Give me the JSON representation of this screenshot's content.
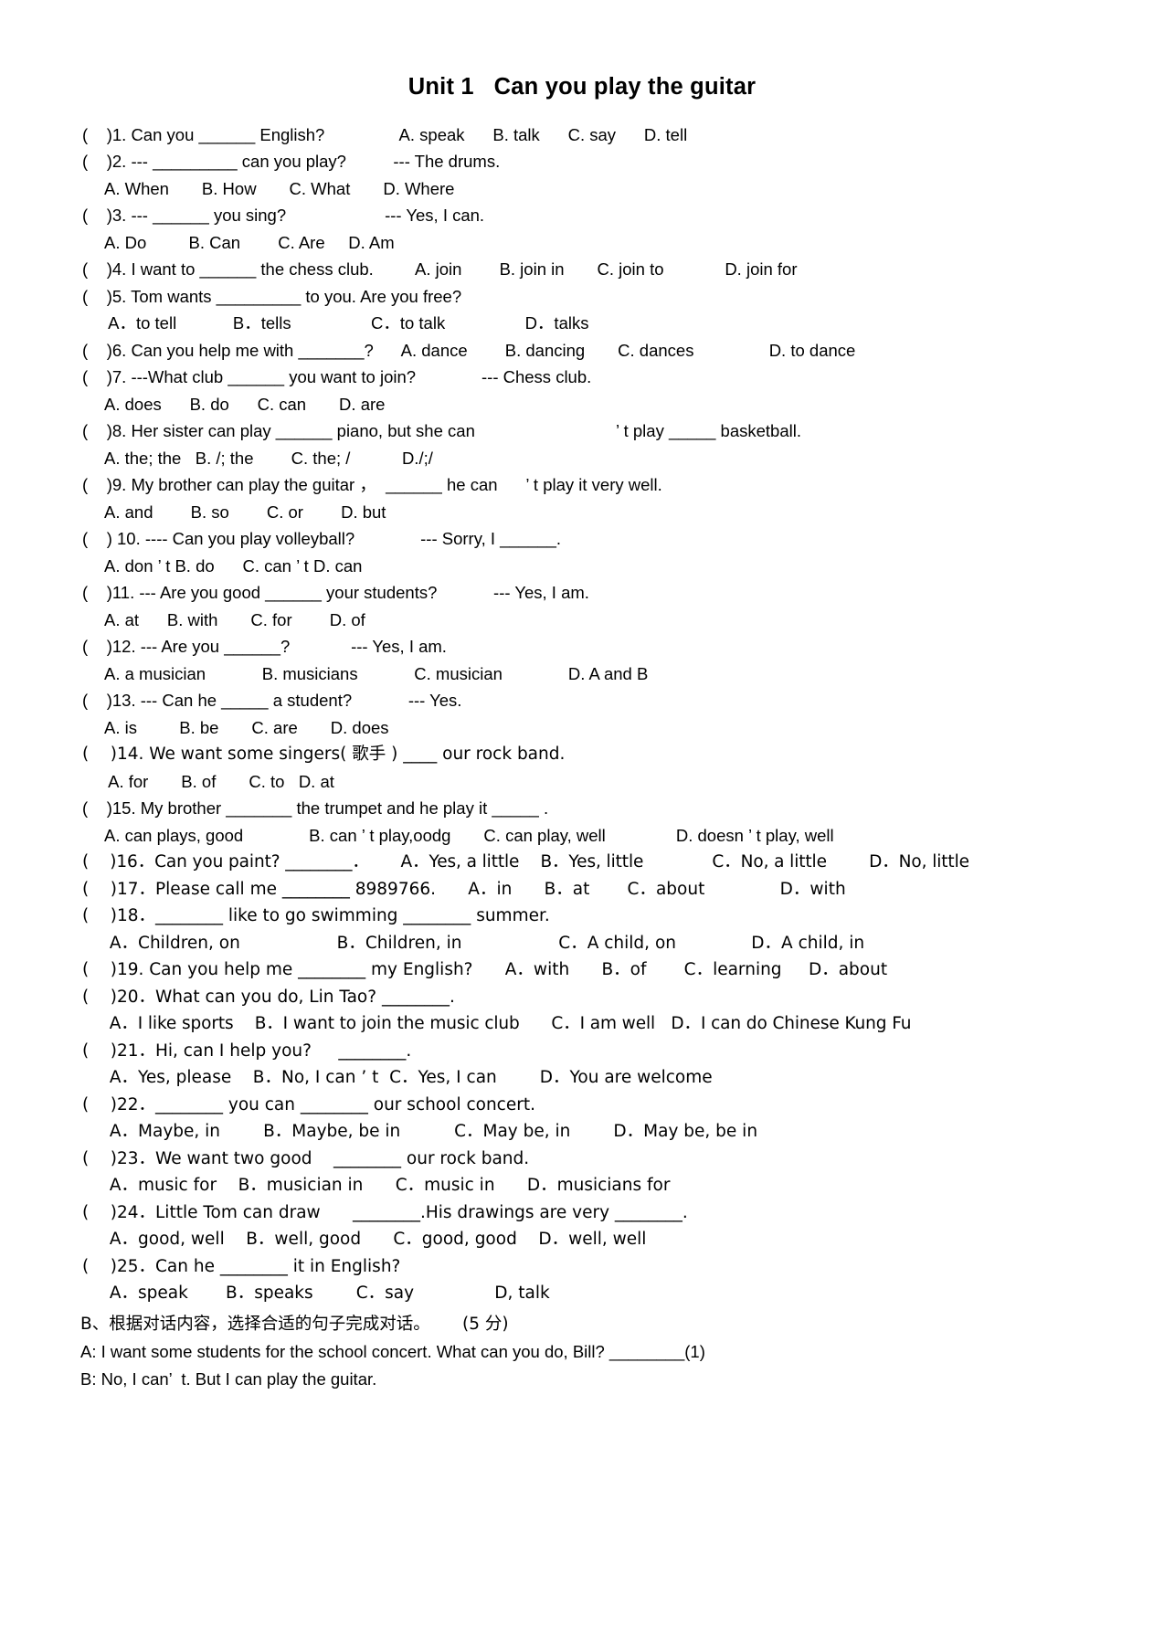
{
  "document": {
    "title": "Unit 1   Can you play the guitar",
    "questions": [
      {
        "stem": "(    )1. Can you ______ English?                A. speak      B. talk      C. say      D. tell",
        "options": null
      },
      {
        "stem": "(    )2. --- _________ can you play?          --- The drums.",
        "options": "A. When       B. How       C. What       D. Where"
      },
      {
        "stem": "(    )3. --- ______ you sing?                     --- Yes, I can.",
        "options": "A. Do         B. Can        C. Are     D. Am"
      },
      {
        "stem": "(    )4. I want to ______ the chess club.         A. join        B. join in       C. join to             D. join for",
        "options": null
      },
      {
        "stem": "(    )5. Tom wants _________ to you. Are you free?",
        "options": " A．to tell            B．tells                 C．to talk                 D．talks"
      },
      {
        "stem": "(    )6. Can you help me with _______?      A. dance        B. dancing       C. dances                D. to dance",
        "options": null
      },
      {
        "stem": "(    )7. ---What club ______ you want to join?              --- Chess club.",
        "options": "A. does      B. do      C. can       D. are"
      },
      {
        "stem": "(    )8. Her sister can play ______ piano, but she can                              ’ t play _____ basketball.",
        "options": "A. the; the   B. /; the        C. the; /           D./;/"
      },
      {
        "stem": "(    )9. My brother can play the guitar ，  ______ he can      ’ t play it very well.",
        "options": "A. and        B. so        C. or        D. but"
      },
      {
        "stem": "(    ) 10. ---- Can you play volleyball?              --- Sorry, I ______.",
        "options": "A. don ’ t B. do      C. can ’ t D. can"
      },
      {
        "stem": "(    )11. --- Are you good ______ your students?            --- Yes, I am.",
        "options": "A. at      B. with       C. for        D. of"
      },
      {
        "stem": "(    )12. --- Are you ______?             --- Yes, I am.",
        "options": "A. a musician            B. musicians            C. musician              D. A and B"
      },
      {
        "stem": "(    )13. --- Can he _____ a student?            --- Yes.",
        "options": "A. is         B. be       C. are       D. does"
      },
      {
        "stem": "(    )14. We want some singers( 歌手 ) ____ our rock band.",
        "options": " A. for       B. of       C. to   D. at"
      },
      {
        "stem": "(    )15. My brother _______ the trumpet and he play it _____ .",
        "options": "A. can plays, good              B. can ’ t play,oodg       C. can play, well               D. doesn ’ t play, well"
      },
      {
        "stem": "(    )16．Can you paint? ________．      A．Yes, a little    B．Yes, little             C．No, a little        D．No, little",
        "options": null
      },
      {
        "stem": "(    )17．Please call me ________ 8989766.      A．in      B．at       C．about              D．with",
        "options": null
      },
      {
        "stem": "(    )18．________ like to go swimming ________ summer.",
        "options": " A．Children, on                  B．Children, in                  C．A child, on              D．A child, in"
      },
      {
        "stem": "(    )19. Can you help me ________ my English?      A．with      B．of       C．learning     D．about",
        "options": null
      },
      {
        "stem": "(    )20．What can you do, Lin Tao? ________.",
        "options": " A．I like sports    B．I want to join the music club      C．I am well   D．I can do Chinese Kung Fu"
      },
      {
        "stem": "(    )21．Hi, can I help you?     ________.",
        "options": " A．Yes, please    B．No, I can ’ t  C．Yes, I can        D．You are welcome"
      },
      {
        "stem": "(    )22．________ you can ________ our school concert.",
        "options": " A．Maybe, in        B．Maybe, be in          C．May be, in        D．May be, be in"
      },
      {
        "stem": "(    )23．We want two good    ________ our rock band.",
        "options": " A．music for    B．musician in      C．music in      D．musicians for"
      },
      {
        "stem": "(    )24．Little Tom can draw      ________.His drawings are very ________.",
        "options": " A．good, well    B．well, good      C．good, good    D．well, well"
      },
      {
        "stem": "(    )25．Can he ________ it in English?",
        "options": " A．speak       B．speaks        C．say               D, talk"
      }
    ],
    "section_b": {
      "heading": "B、根据对话内容，选择合适的句子完成对话。      (5 分)",
      "dialogue": [
        "A: I want some students for the school concert. What can you do, Bill? ________(1)",
        "B: No, I can’  t. But I can play the guitar."
      ]
    }
  }
}
